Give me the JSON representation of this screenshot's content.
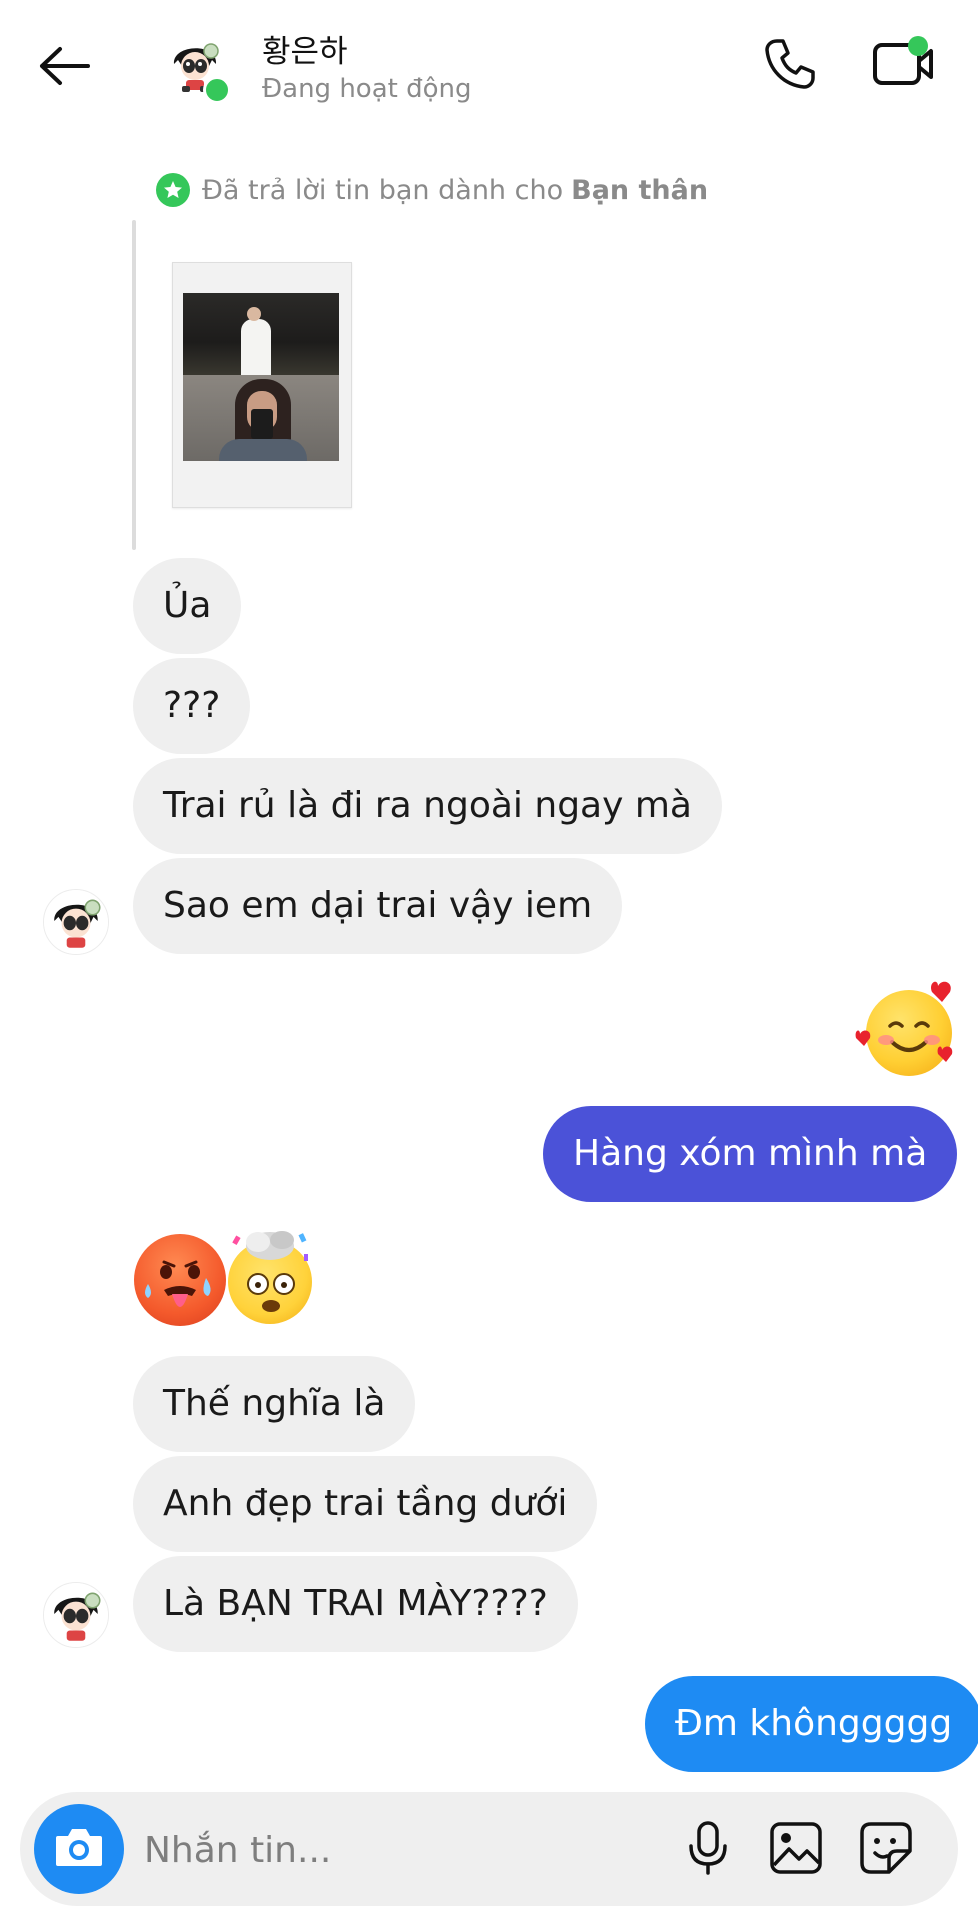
{
  "header": {
    "contact_name": "황은하",
    "status": "Đang hoạt động",
    "back_icon": "arrow-left-icon",
    "call_icon": "phone-icon",
    "video_icon": "video-camera-icon",
    "online_color": "#35c75a"
  },
  "reply_note": {
    "text": "Đã trả lời tin bạn dành cho",
    "audience": "Bạn thân",
    "icon": "star-icon"
  },
  "messages": [
    {
      "from": "them",
      "type": "text",
      "text": "Ủa"
    },
    {
      "from": "them",
      "type": "text",
      "text": "???"
    },
    {
      "from": "them",
      "type": "text",
      "text": "Trai rủ là đi ra ngoài ngay mà"
    },
    {
      "from": "them",
      "type": "text",
      "text": "Sao em dại trai vậy iem"
    },
    {
      "from": "me",
      "type": "emoji",
      "emoji": "smiling-face-with-hearts"
    },
    {
      "from": "me",
      "type": "text",
      "text": "Hàng xóm mình mà"
    },
    {
      "from": "them",
      "type": "emoji",
      "emoji": "hot-face"
    },
    {
      "from": "them",
      "type": "emoji",
      "emoji": "exploding-head"
    },
    {
      "from": "them",
      "type": "text",
      "text": "Thế nghĩa là"
    },
    {
      "from": "them",
      "type": "text",
      "text": "Anh đẹp trai tầng dưới"
    },
    {
      "from": "them",
      "type": "text",
      "text": "Là BẠN TRAI MÀY????"
    },
    {
      "from": "me",
      "type": "text",
      "text": "Đm khônggggg"
    }
  ],
  "colors": {
    "outgoing_purple": "#4b52d8",
    "outgoing_blue": "#1e8bf3",
    "incoming_bg": "#efefef"
  },
  "composer": {
    "placeholder": "Nhắn tin...",
    "camera_icon": "camera-icon",
    "mic_icon": "microphone-icon",
    "gallery_icon": "image-icon",
    "sticker_icon": "sticker-icon"
  }
}
